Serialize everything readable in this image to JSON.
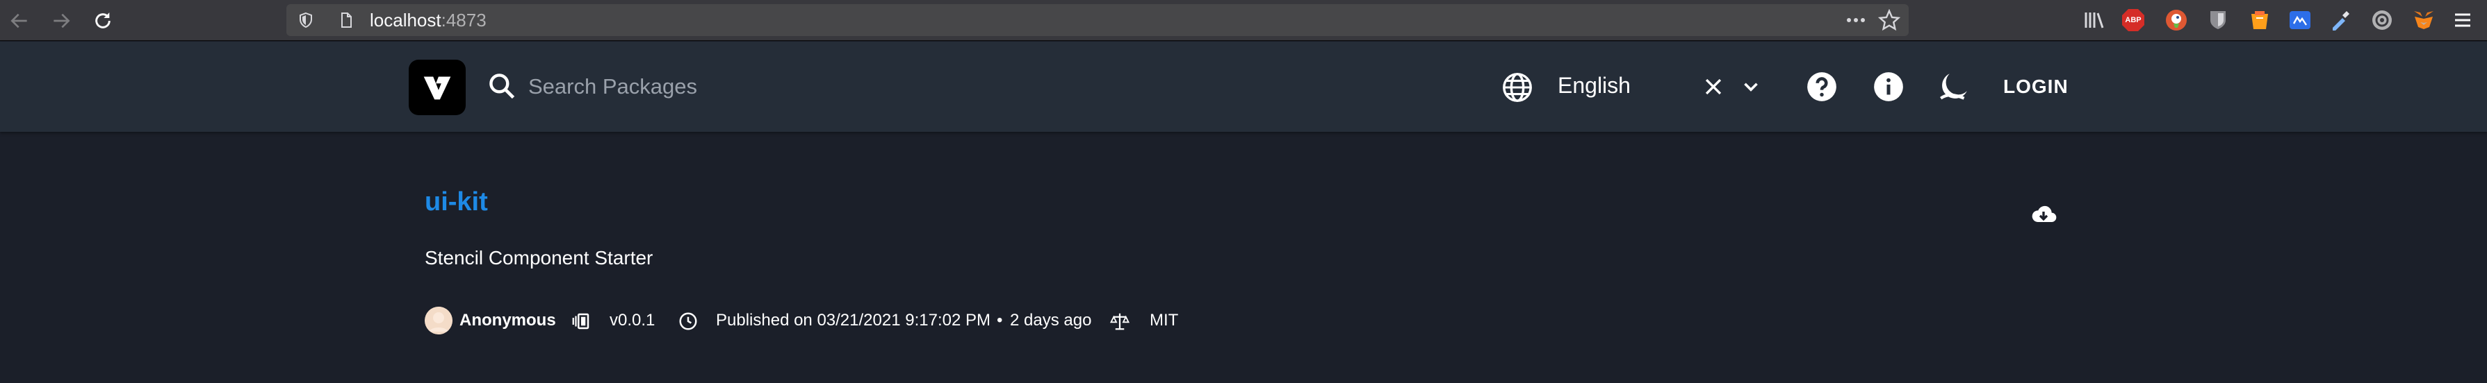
{
  "browser": {
    "url_host": "localhost",
    "url_port": ":4873",
    "icons": [
      "back-icon",
      "forward-icon",
      "reload-icon",
      "tracking-shield-icon",
      "page-icon",
      "more-icon",
      "bookmark-star-icon",
      "library-icon",
      "adblock-icon",
      "duckduckgo-icon",
      "bitwarden-icon",
      "container-icon",
      "extension-icon",
      "dropper-icon",
      "vpn-icon",
      "metamask-icon",
      "menu-icon"
    ],
    "adblock_label": "ABP"
  },
  "header": {
    "search": {
      "placeholder": "Search Packages",
      "value": ""
    },
    "language": "English",
    "login_label": "LOGIN"
  },
  "package": {
    "name": "ui-kit",
    "description": "Stencil Component Starter",
    "author": "Anonymous",
    "version": "v0.0.1",
    "published": "Published on 03/21/2021 9:17:02 PM",
    "separator": "•",
    "relative_time": "2 days ago",
    "license": "MIT"
  },
  "colors": {
    "header_bg": "#252d38",
    "page_bg": "#1b1f29",
    "accent": "#1e8ae6"
  }
}
